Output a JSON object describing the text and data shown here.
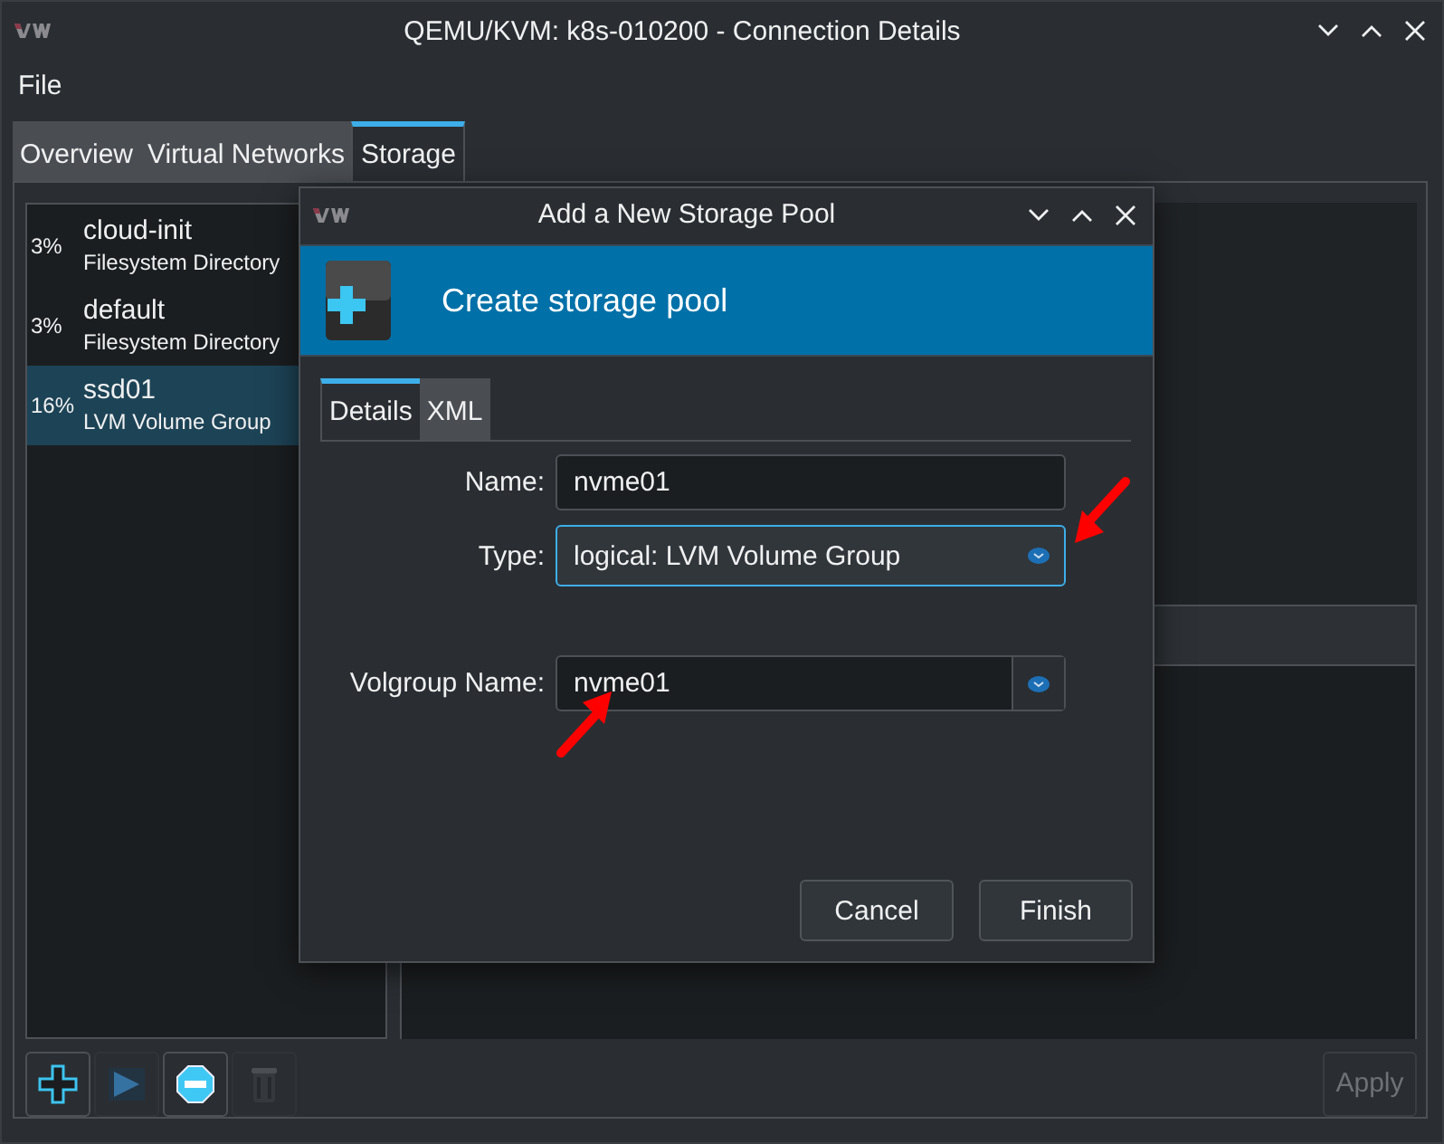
{
  "window": {
    "title": "QEMU/KVM: k8s-010200 - Connection Details"
  },
  "menu": [
    "File"
  ],
  "tabs": [
    {
      "label": "Overview",
      "selected": false
    },
    {
      "label": "Virtual Networks",
      "selected": false
    },
    {
      "label": "Storage",
      "selected": true
    }
  ],
  "pools": [
    {
      "usage": "3%",
      "name": "cloud-init",
      "type": "Filesystem Directory",
      "selected": false
    },
    {
      "usage": "3%",
      "name": "default",
      "type": "Filesystem Directory",
      "selected": false
    },
    {
      "usage": "16%",
      "name": "ssd01",
      "type": "LVM Volume Group",
      "selected": true
    }
  ],
  "toolbar": [
    {
      "kind": "add",
      "disabled": false
    },
    {
      "kind": "start",
      "disabled": true
    },
    {
      "kind": "stop",
      "disabled": false
    },
    {
      "kind": "delete",
      "disabled": true
    }
  ],
  "apply": {
    "label": "Apply",
    "disabled": true
  },
  "dialog": {
    "title": "Add a New Storage Pool",
    "banner": "Create storage pool",
    "tabs": [
      {
        "label": "Details",
        "selected": true
      },
      {
        "label": "XML",
        "selected": false
      }
    ],
    "fields": [
      {
        "kind": "text",
        "label": "Name:",
        "value": "nvme01"
      },
      {
        "kind": "select",
        "label": "Type:",
        "value": "logical: LVM Volume Group",
        "focused": true
      },
      {
        "kind": "combo",
        "label": "Volgroup Name:",
        "value": "nvme01"
      }
    ],
    "buttons": [
      "Cancel",
      "Finish"
    ]
  }
}
